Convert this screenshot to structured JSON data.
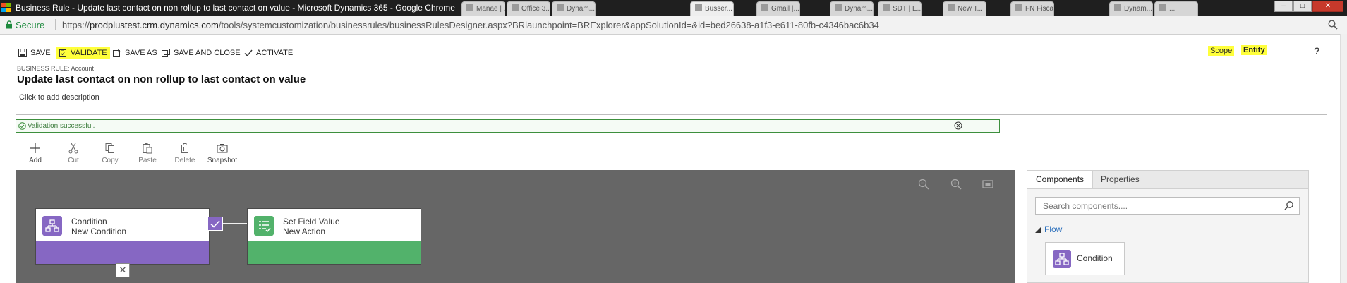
{
  "window": {
    "title": "Business Rule - Update last contact on non rollup to last contact on value - Microsoft Dynamics 365 - Google Chrome",
    "background_tabs": [
      "Manae | ...",
      "Office 3...",
      "Dynam...",
      "Busser...",
      "Gmail |...",
      "Dynam...",
      "SDT | E...",
      "New T...",
      "FN Fiscal...",
      "Dynam...",
      "..."
    ],
    "controls": {
      "minimize": "–",
      "maximize": "□",
      "close": "✕"
    }
  },
  "addressbar": {
    "secure_label": "Secure",
    "url_scheme": "https://",
    "url_host": "prodplustest.crm.dynamics.com",
    "url_path": "/tools/systemcustomization/businessrules/businessRulesDesigner.aspx?BRlaunchpoint=BRExplorer&appSolutionId=&id=bed26638-a1f3-e611-80fb-c4346bac6b34"
  },
  "commandbar": {
    "save": "SAVE",
    "validate": "VALIDATE",
    "save_as": "SAVE AS",
    "save_and_close": "SAVE AND CLOSE",
    "activate": "ACTIVATE",
    "scope": "Scope",
    "entity": "Entity",
    "help": "?"
  },
  "rule": {
    "entity_label": "BUSINESS RULE: Account",
    "title": "Update last contact on non rollup to last contact on value",
    "description_placeholder": "Click to add description"
  },
  "validation": {
    "message": "Validation successful.",
    "status_color": "#3d8f3d"
  },
  "toolbar": {
    "items": [
      {
        "label": "Add",
        "icon": "plus-icon"
      },
      {
        "label": "Cut",
        "icon": "scissors-icon"
      },
      {
        "label": "Copy",
        "icon": "copy-icon"
      },
      {
        "label": "Paste",
        "icon": "paste-icon"
      },
      {
        "label": "Delete",
        "icon": "trash-icon"
      },
      {
        "label": "Snapshot",
        "icon": "camera-icon"
      }
    ]
  },
  "canvas": {
    "nodes": [
      {
        "type": "Condition",
        "name": "New Condition",
        "color": "#8667c3"
      },
      {
        "type": "Set Field Value",
        "name": "New Action",
        "color": "#52b26b"
      }
    ]
  },
  "panel": {
    "tabs": [
      "Components",
      "Properties"
    ],
    "search_placeholder": "Search components....",
    "flow_header": "Flow",
    "components": [
      {
        "label": "Condition",
        "color": "#8667c3"
      }
    ]
  },
  "colors": {
    "highlight": "#ffff3b",
    "canvas_background": "#666666",
    "link": "#2a6ebb"
  }
}
